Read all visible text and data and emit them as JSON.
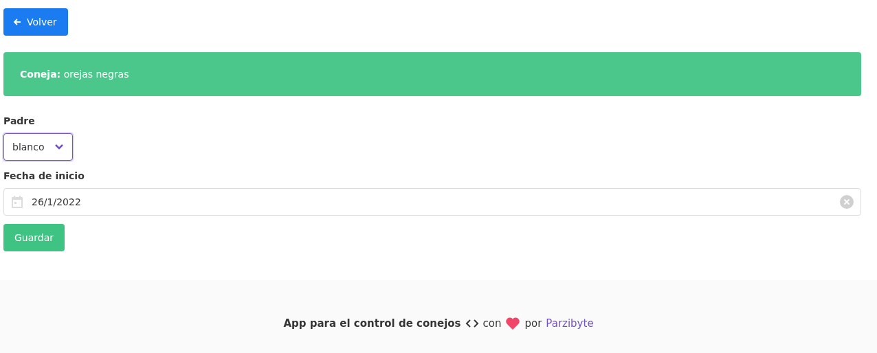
{
  "back_button": {
    "label": "Volver"
  },
  "notification": {
    "text": "**Coneja:** orejas negras"
  },
  "form": {
    "father": {
      "label": "Padre",
      "value": "blanco",
      "focused": true
    },
    "start_date": {
      "label": "Fecha de inicio",
      "value": "26/1/2022"
    },
    "save_button": {
      "label": "Guardar"
    }
  },
  "footer": {
    "title": "App para el control de conejos",
    "with": "con",
    "by": "por",
    "author_link": "Parzibyte"
  }
}
